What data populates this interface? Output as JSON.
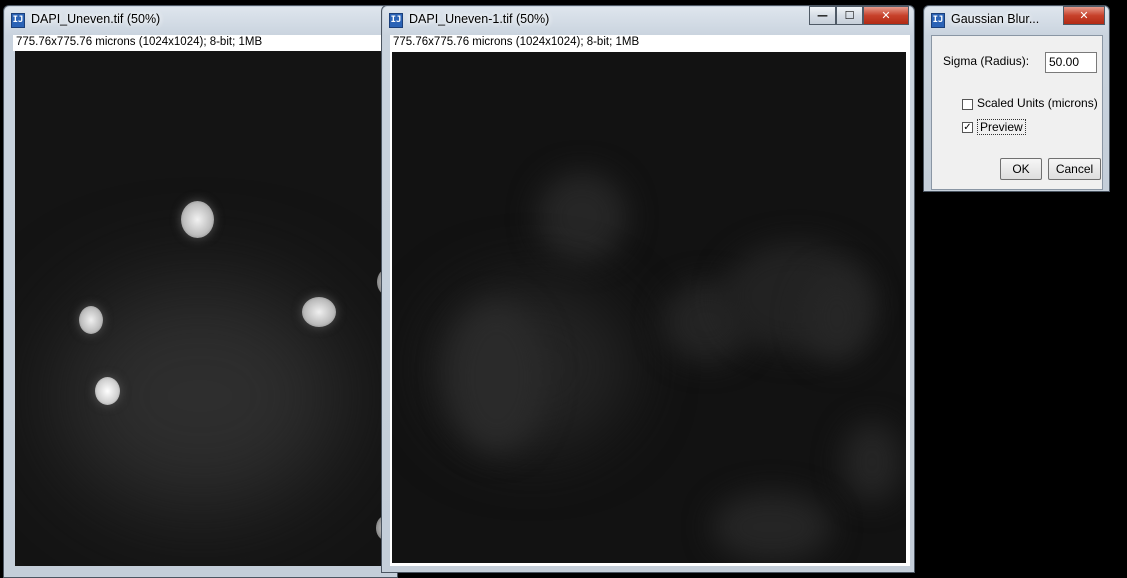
{
  "windows": [
    {
      "title": "DAPI_Uneven.tif (50%)",
      "info": "775.76x775.76 microns (1024x1024); 8-bit; 1MB"
    },
    {
      "title": "DAPI_Uneven-1.tif (50%)",
      "info": "775.76x775.76 microns (1024x1024); 8-bit; 1MB",
      "controls": {
        "minimize": "—",
        "maximize": "☐",
        "close": "✕"
      }
    }
  ],
  "dialog": {
    "title": "Gaussian Blur...",
    "close": "✕",
    "sigma_label": "Sigma (Radius):",
    "sigma_value": "50.00",
    "scaled_units_label": "Scaled Units (microns)",
    "scaled_units_checked": false,
    "preview_label": "Preview",
    "preview_checked": true,
    "check_mark": "✓",
    "ok_label": "OK",
    "cancel_label": "Cancel"
  },
  "icons": {
    "app_icon": "imagej-icon",
    "app_icon_glyph": "IJ"
  }
}
